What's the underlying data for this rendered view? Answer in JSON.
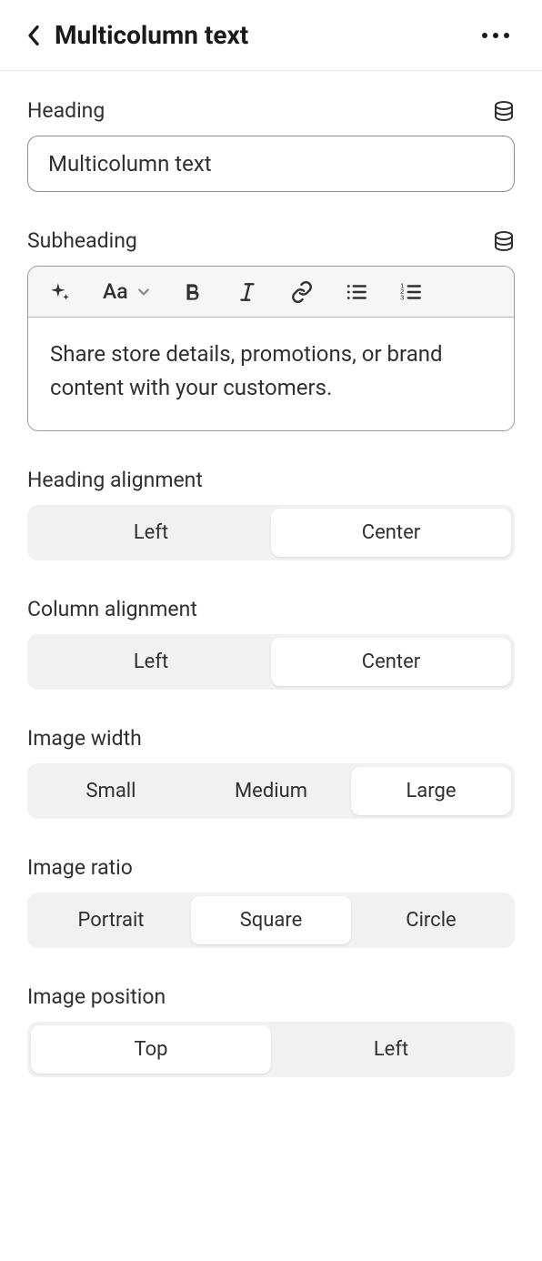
{
  "header": {
    "title": "Multicolumn text"
  },
  "heading_field": {
    "label": "Heading",
    "value": "Multicolumn text"
  },
  "subheading_field": {
    "label": "Subheading",
    "body": "Share store details, promotions, or brand content with your customers.",
    "toolbar_aa": "Aa"
  },
  "heading_alignment": {
    "label": "Heading alignment",
    "options": [
      "Left",
      "Center"
    ],
    "selected": 1
  },
  "column_alignment": {
    "label": "Column alignment",
    "options": [
      "Left",
      "Center"
    ],
    "selected": 1
  },
  "image_width": {
    "label": "Image width",
    "options": [
      "Small",
      "Medium",
      "Large"
    ],
    "selected": 2
  },
  "image_ratio": {
    "label": "Image ratio",
    "options": [
      "Portrait",
      "Square",
      "Circle"
    ],
    "selected": 1
  },
  "image_position": {
    "label": "Image position",
    "options": [
      "Top",
      "Left"
    ],
    "selected": 0
  }
}
